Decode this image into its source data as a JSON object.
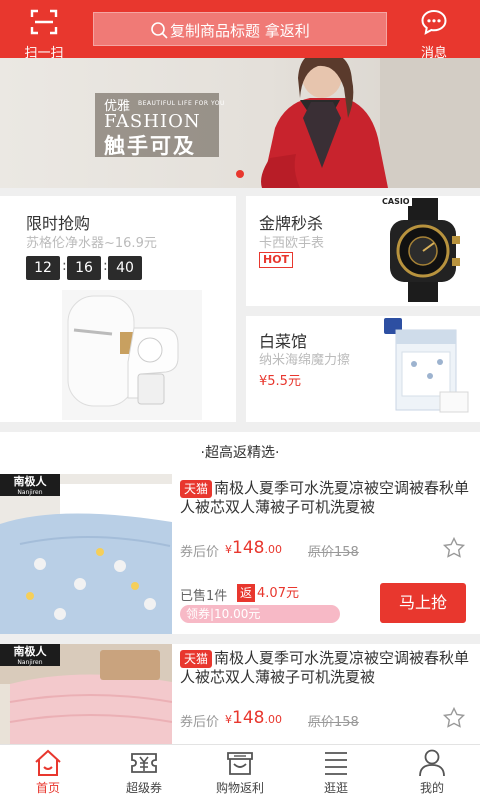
{
  "header": {
    "scan_label": "扫一扫",
    "search_placeholder": "复制商品标题  拿返利",
    "message_label": "消息"
  },
  "banner": {
    "tag_cn": "优雅",
    "tag_en_small": "BEAUTIFUL LIFE FOR YOU",
    "tag_en": "FASHION",
    "tag_slogan": "触手可及"
  },
  "flash_sale": {
    "title": "限时抢购",
    "subtitle": "苏格伦净水器~16.9元",
    "timer": [
      "12",
      "16",
      "40"
    ]
  },
  "gold_sale": {
    "title": "金牌秒杀",
    "subtitle": "卡西欧手表",
    "badge": "HOT",
    "product_brand": "CASIO"
  },
  "cabbage": {
    "title": "白菜馆",
    "subtitle": "纳米海绵魔力擦",
    "price": "¥5.5元"
  },
  "section": {
    "title": "·超高返精选·"
  },
  "products": [
    {
      "brand_logo": "南极人",
      "brand_logo_en": "Nanjiren",
      "platform": "天猫",
      "title": "南极人夏季可水洗夏凉被空调被春秋单人被芯双人薄被子可机洗夏被",
      "coupon_label": "券后价",
      "currency": "¥",
      "price_int": "148",
      "price_dec": ".00",
      "original": "原价158",
      "sold": "已售1件",
      "rebate_label": "返",
      "rebate_value": "4.07元",
      "coupon_text": "领券|10.00元",
      "buy_label": "马上抢"
    },
    {
      "brand_logo": "南极人",
      "brand_logo_en": "Nanjiren",
      "platform": "天猫",
      "title": "南极人夏季可水洗夏凉被空调被春秋单人被芯双人薄被子可机洗夏被",
      "coupon_label": "券后价",
      "currency": "¥",
      "price_int": "148",
      "price_dec": ".00",
      "original": "原价158"
    }
  ],
  "tabbar": {
    "items": [
      {
        "label": "首页",
        "icon": "home-icon",
        "active": true
      },
      {
        "label": "超级券",
        "icon": "coupon-icon",
        "active": false
      },
      {
        "label": "购物返利",
        "icon": "store-icon",
        "active": false
      },
      {
        "label": "逛逛",
        "icon": "list-icon",
        "active": false
      },
      {
        "label": "我的",
        "icon": "user-icon",
        "active": false
      }
    ]
  },
  "colors": {
    "brand": "#e8372e",
    "coupon_bar": "#f7b9c6",
    "timer_bg": "#2b2b2b"
  }
}
